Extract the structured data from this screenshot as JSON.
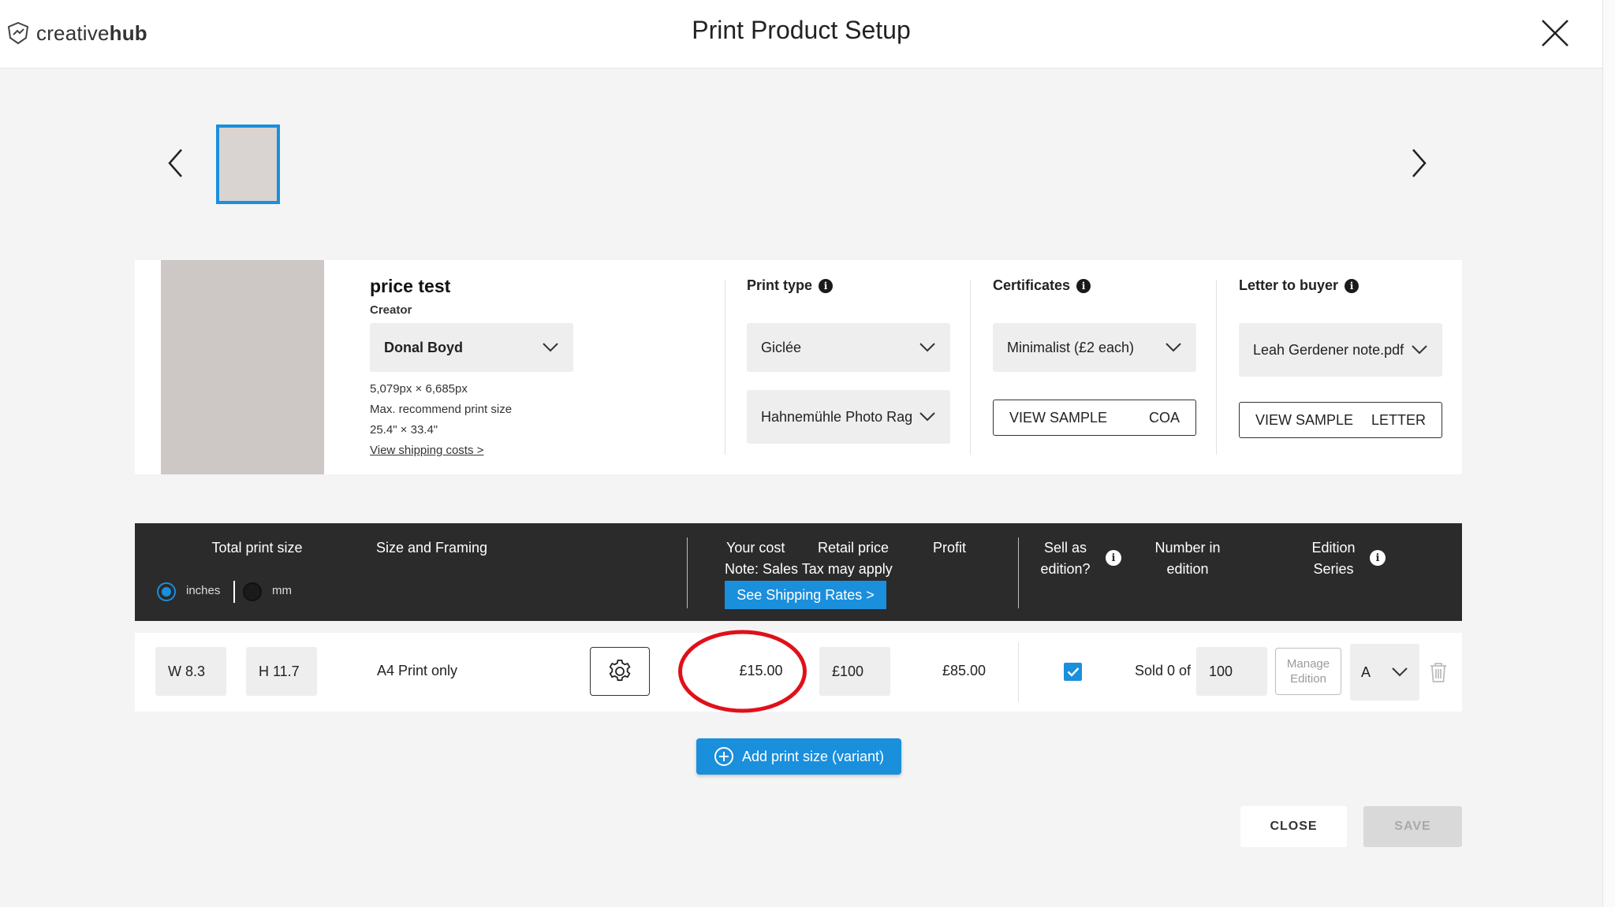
{
  "app": {
    "logo_text_light": "creative",
    "logo_text_bold": "hub",
    "title": "Print Product Setup"
  },
  "product": {
    "title": "price test",
    "creator_label": "Creator",
    "creator_value": "Donal Boyd",
    "pixels": "5,079px × 6,685px",
    "max_label": "Max. recommend print size",
    "max_size": "25.4\" × 33.4\"",
    "shipping_link": "View shipping costs >"
  },
  "print_type": {
    "label": "Print type",
    "type_value": "Giclée",
    "paper_value": "Hahnemühle Photo Rag"
  },
  "certificates": {
    "label": "Certificates",
    "value": "Minimalist (£2 each)",
    "view_sample": "VIEW SAMPLE",
    "sample_kind": "COA"
  },
  "letter": {
    "label": "Letter to buyer",
    "value": "Leah Gerdener note.pdf",
    "view_sample": "VIEW SAMPLE",
    "sample_kind": "LETTER"
  },
  "table_header": {
    "total_print_size": "Total print size",
    "unit_inches": "inches",
    "unit_mm": "mm",
    "size_framing": "Size and Framing",
    "your_cost": "Your cost",
    "retail_price": "Retail price",
    "profit": "Profit",
    "tax_note": "Note: Sales Tax may apply",
    "shipping_rates_btn": "See Shipping Rates >",
    "sell_as_edition": "Sell as edition?",
    "number_in_edition": "Number in edition",
    "edition_series": "Edition Series"
  },
  "variant": {
    "width": "W 8.3",
    "height": "H 11.7",
    "framing": "A4 Print only",
    "your_cost": "£15.00",
    "retail_price": "£100",
    "profit": "£85.00",
    "sold_label": "Sold 0 of",
    "edition_number": "100",
    "manage_edition": "Manage Edition",
    "series": "A",
    "sell_as_edition_checked": true
  },
  "actions": {
    "add_variant": "Add print size (variant)",
    "close": "CLOSE",
    "save": "SAVE"
  },
  "colors": {
    "accent": "#1a8fdc",
    "header_dark": "#2b2b2b",
    "highlight_ring": "#e0101a"
  }
}
